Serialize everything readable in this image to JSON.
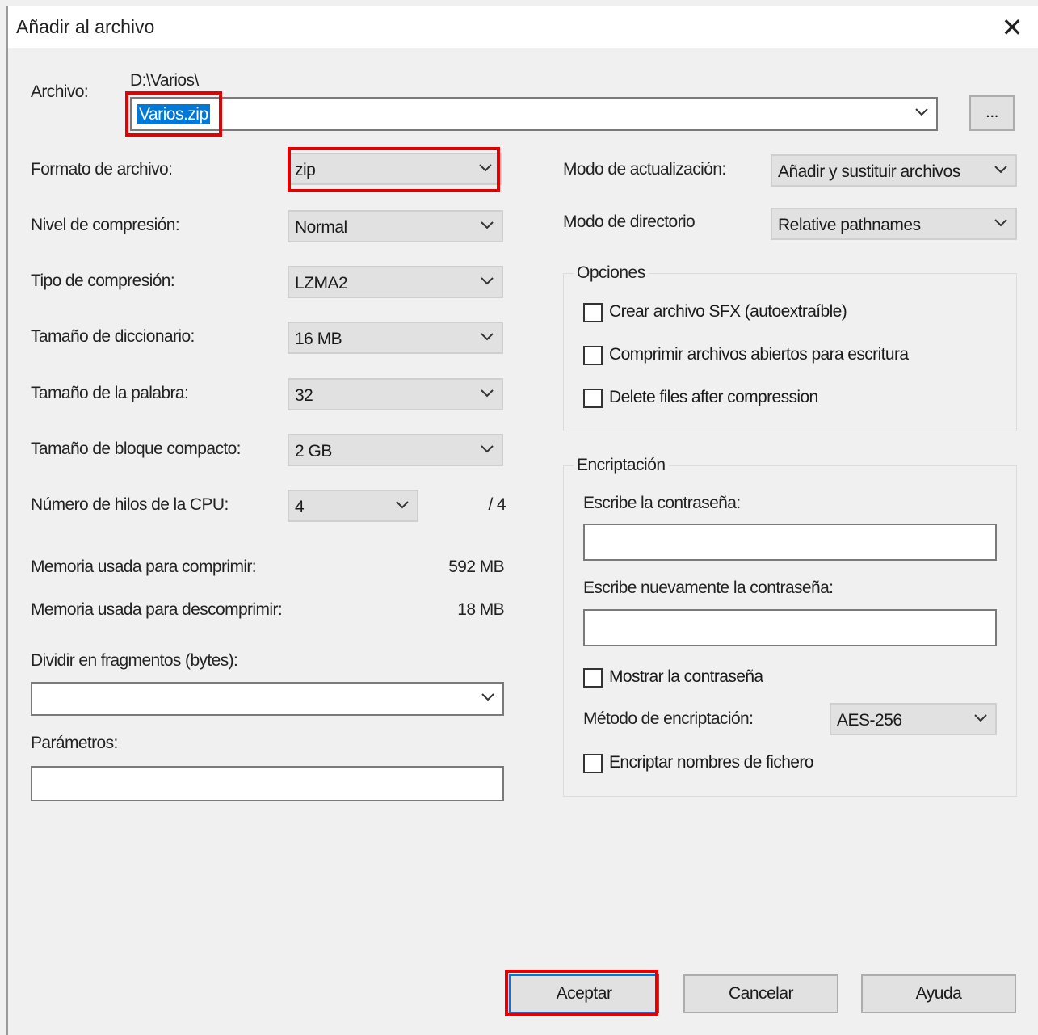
{
  "window": {
    "title": "Añadir al archivo",
    "close_symbol": "✕"
  },
  "archive": {
    "label": "Archivo:",
    "path": "D:\\Varios\\",
    "name": "Varios.zip",
    "browse": "..."
  },
  "left": {
    "format": {
      "label": "Formato de archivo:",
      "value": "zip"
    },
    "level": {
      "label": "Nivel de compresión:",
      "value": "Normal"
    },
    "method": {
      "label": "Tipo de compresión:",
      "value": "LZMA2"
    },
    "dict": {
      "label": "Tamaño de diccionario:",
      "value": "16 MB"
    },
    "word": {
      "label": "Tamaño de la palabra:",
      "value": "32"
    },
    "block": {
      "label": "Tamaño de bloque compacto:",
      "value": "2 GB"
    },
    "threads": {
      "label": "Número de hilos de la CPU:",
      "value": "4",
      "max": "/ 4"
    },
    "mem_compress": {
      "label": "Memoria usada para comprimir:",
      "value": "592 MB"
    },
    "mem_decompress": {
      "label": "Memoria usada para descomprimir:",
      "value": "18 MB"
    },
    "split": {
      "label": "Dividir en fragmentos (bytes):",
      "value": ""
    },
    "params": {
      "label": "Parámetros:",
      "value": ""
    }
  },
  "right": {
    "update_mode": {
      "label": "Modo de actualización:",
      "value": "Añadir y sustituir archivos"
    },
    "path_mode": {
      "label": "Modo de directorio",
      "value": "Relative pathnames"
    },
    "options": {
      "title": "Opciones",
      "sfx": "Crear archivo SFX (autoextraíble)",
      "shared": "Comprimir archivos abiertos para escritura",
      "delete": "Delete files after compression"
    },
    "encryption": {
      "title": "Encriptación",
      "password_label": "Escribe la contraseña:",
      "repeat_label": "Escribe nuevamente la contraseña:",
      "show_password": "Mostrar la contraseña",
      "method_label": "Método de encriptación:",
      "method_value": "AES-256",
      "encrypt_names": "Encriptar nombres de fichero"
    }
  },
  "buttons": {
    "ok": "Aceptar",
    "cancel": "Cancelar",
    "help": "Ayuda"
  },
  "colors": {
    "highlight": "#e20000",
    "selection": "#0078d7",
    "dialog_bg": "#f0f0f0"
  }
}
